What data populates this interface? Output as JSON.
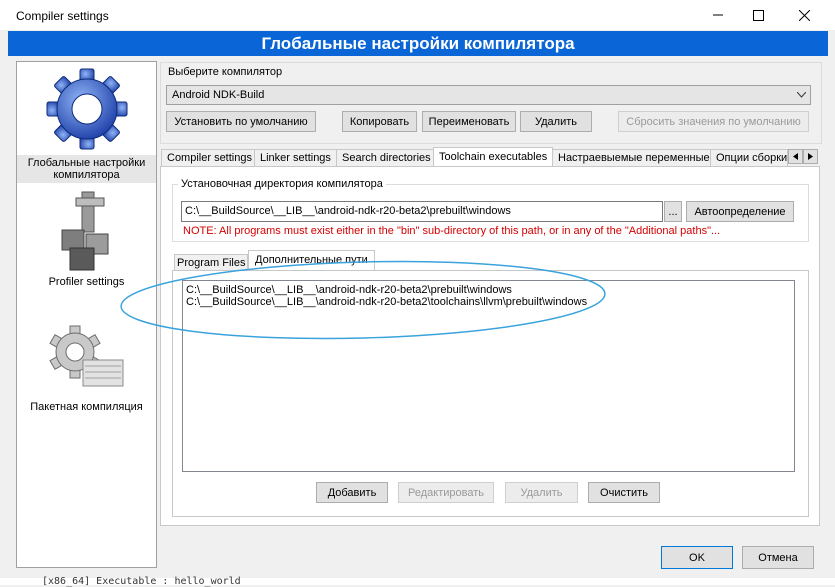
{
  "window": {
    "title": "Compiler settings",
    "minimize_label": "—",
    "maximize_label": "☐",
    "close_label": "✕"
  },
  "header": {
    "title": "Глобальные настройки компилятора"
  },
  "sidebar": {
    "items": [
      {
        "label": "Глобальные настройки компилятора",
        "icon": "gear-icon",
        "selected": true
      },
      {
        "label": "Profiler settings",
        "icon": "profiler-icon",
        "selected": false
      },
      {
        "label": "Пакетная компиляция",
        "icon": "batch-build-icon",
        "selected": false
      }
    ]
  },
  "compiler": {
    "group_label": "Выберите компилятор",
    "selected": "Android NDK-Build",
    "buttons": {
      "set_default": "Установить по умолчанию",
      "copy": "Копировать",
      "rename": "Переименовать",
      "delete": "Удалить",
      "reset": "Сбросить значения по умолчанию"
    }
  },
  "tabs": [
    {
      "label": "Compiler settings",
      "active": false
    },
    {
      "label": "Linker settings",
      "active": false
    },
    {
      "label": "Search directories",
      "active": false
    },
    {
      "label": "Toolchain executables",
      "active": true
    },
    {
      "label": "Настраевыемые переменные",
      "active": false
    },
    {
      "label": "Опции сборки",
      "active": false
    }
  ],
  "toolchain": {
    "install_dir_label": "Установочная директория компилятора",
    "install_dir_value": "C:\\__BuildSource\\__LIB__\\android-ndk-r20-beta2\\prebuilt\\windows",
    "browse_label": "...",
    "autodetect_label": "Автоопределение",
    "note": "NOTE: All programs must exist either in the \"bin\" sub-directory of this path, or in any of the \"Additional paths\"..."
  },
  "subtabs": [
    {
      "label": "Program Files",
      "active": false
    },
    {
      "label": "Дополнительные пути",
      "active": true
    }
  ],
  "additional_paths": [
    "C:\\__BuildSource\\__LIB__\\android-ndk-r20-beta2\\prebuilt\\windows",
    "C:\\__BuildSource\\__LIB__\\android-ndk-r20-beta2\\toolchains\\llvm\\prebuilt\\windows"
  ],
  "path_buttons": {
    "add": "Добавить",
    "edit": "Редактировать",
    "delete": "Удалить",
    "clear": "Очистить"
  },
  "dialog_buttons": {
    "ok": "OK",
    "cancel": "Отмена"
  },
  "console_line": "[x86_64] Executable     : hello_world"
}
